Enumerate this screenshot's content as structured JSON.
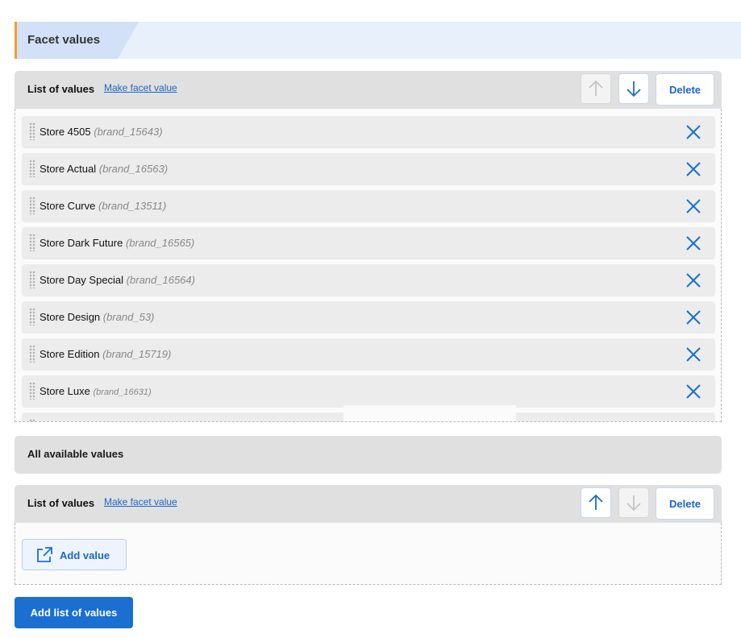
{
  "section": {
    "title": "Facet values"
  },
  "list1": {
    "title": "List of values",
    "link": "Make facet value",
    "up_disabled": true,
    "down_disabled": false,
    "delete_label": "Delete",
    "items": [
      {
        "name": "Store 4505",
        "code": "(brand_15643)"
      },
      {
        "name": "Store Actual",
        "code": "(brand_16563)"
      },
      {
        "name": "Store Curve",
        "code": "(brand_13511)"
      },
      {
        "name": "Store Dark Future",
        "code": "(brand_16565)"
      },
      {
        "name": "Store Day Special",
        "code": "(brand_16564)"
      },
      {
        "name": "Store Design",
        "code": "(brand_53)"
      },
      {
        "name": "Store Edition",
        "code": "(brand_15719)"
      },
      {
        "name": "Store Luxe",
        "code": "(brand_16631)"
      }
    ]
  },
  "available": {
    "title": "All available values"
  },
  "list2": {
    "title": "List of values",
    "link": "Make facet value",
    "up_disabled": false,
    "down_disabled": true,
    "delete_label": "Delete",
    "add_value_label": "Add value"
  },
  "add_list_label": "Add list of values",
  "colors": {
    "accent": "#1a6fd1",
    "link": "#1a66c9",
    "tab_marker": "#f0a030"
  }
}
